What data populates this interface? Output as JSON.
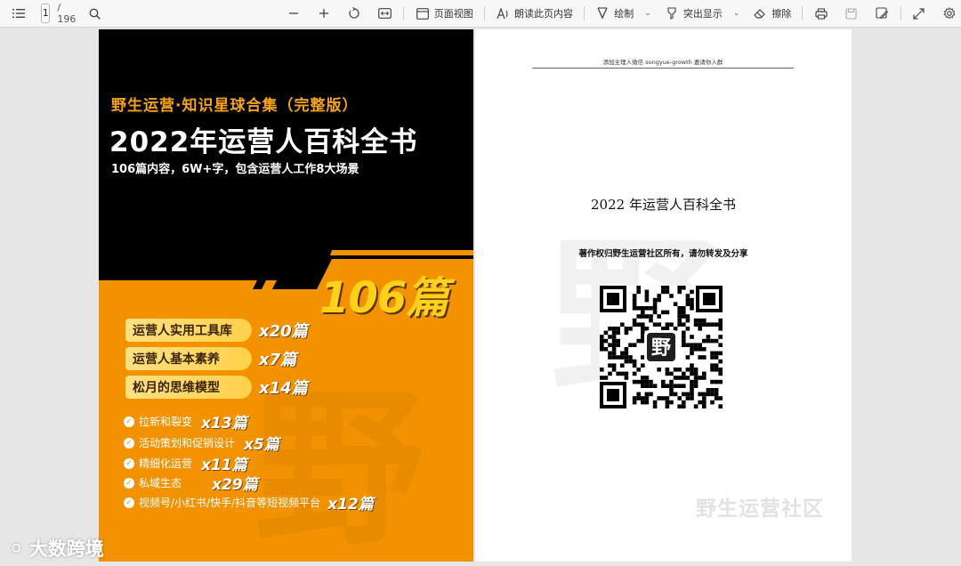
{
  "toolbar": {
    "page_current": "1",
    "page_total": "/ 196",
    "page_view_label": "页面视图",
    "read_aloud_label": "朗读此页内容",
    "draw_label": "绘制",
    "highlight_label": "突出显示",
    "erase_label": "擦除",
    "icons": [
      "toc-icon",
      "search-icon",
      "zoom-out-icon",
      "zoom-in-icon",
      "rotate-icon",
      "fit-width-icon",
      "page-view-icon",
      "read-aloud-icon",
      "draw-icon",
      "highlight-icon",
      "eraser-icon",
      "print-icon",
      "save-icon",
      "save-as-icon",
      "fullscreen-icon",
      "settings-icon"
    ]
  },
  "cover": {
    "subtitle": "野生运营·知识星球合集（完整版）",
    "title": "2022年运营人百科全书",
    "description": "106篇内容，6W+字，包含运营人工作8大场景",
    "big_count": "106篇",
    "pills": [
      {
        "label": "运营人实用工具库",
        "count": "x20篇"
      },
      {
        "label": "运营人基本素养",
        "count": "x7篇"
      },
      {
        "label": "松月的思维模型",
        "count": "x14篇"
      }
    ],
    "checks": [
      {
        "label": "拉新和裂变",
        "count": "x13篇"
      },
      {
        "label": "活动策划和促销设计",
        "count": "x5篇"
      },
      {
        "label": "精细化运营",
        "count": "x11篇"
      },
      {
        "label": "私域生态",
        "count": "x29篇"
      },
      {
        "label": "视频号/小红书/快手/抖音等短视频平台",
        "count": "x12篇"
      }
    ],
    "colors": {
      "orange": "#f39200",
      "black": "#000000",
      "yellow": "#ffd11a"
    }
  },
  "page2": {
    "header": "添加主理人微信 songyue-growth 邀请你入群",
    "title": "2022 年运营人百科全书",
    "note": "著作权归野生运营社区所有，请勿转发及分享",
    "footer": "野生运营社区",
    "qr_center": "野"
  },
  "watermark": {
    "text": "大数跨境"
  }
}
